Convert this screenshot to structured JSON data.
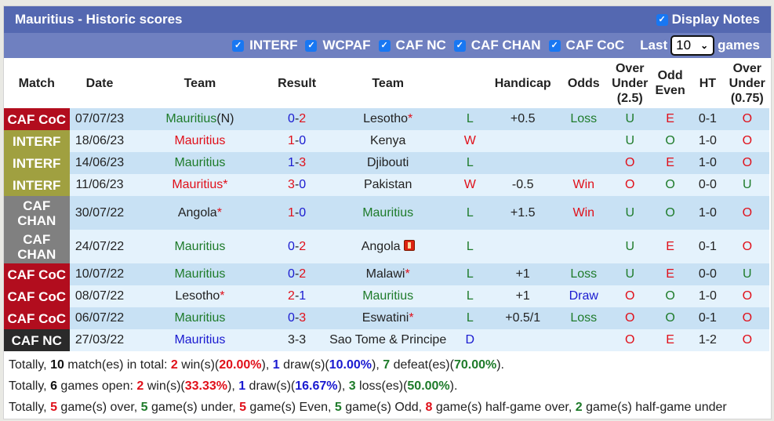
{
  "header": {
    "title": "Mauritius - Historic scores",
    "display_notes_label": "Display Notes",
    "display_notes_checked": true
  },
  "filters": {
    "items": [
      {
        "label": "INTERF",
        "checked": true
      },
      {
        "label": "WCPAF",
        "checked": true
      },
      {
        "label": "CAF NC",
        "checked": true
      },
      {
        "label": "CAF CHAN",
        "checked": true
      },
      {
        "label": "CAF CoC",
        "checked": true
      }
    ],
    "last_label": "Last",
    "last_value": "10",
    "games_label": "games"
  },
  "table": {
    "columns": [
      "Match",
      "Date",
      "Team",
      "Result",
      "Team",
      "",
      "Handicap",
      "Odds",
      "Over Under (2.5)",
      "Odd Even",
      "HT",
      "Over Under (0.75)"
    ],
    "column_lines": {
      "ou25": [
        "Over",
        "Under",
        "(2.5)"
      ],
      "oddeven": [
        "Odd",
        "Even"
      ],
      "ou075": [
        "Over",
        "Under",
        "(0.75)"
      ]
    },
    "rows": [
      {
        "match": "CAF CoC",
        "match_type": "coc",
        "date": "07/07/23",
        "home": "Mauritius",
        "home_suffix": "(N)",
        "home_color": "green",
        "home_star": false,
        "score_h": "0",
        "score_a": "2",
        "score_h_color": "blue",
        "score_a_color": "red",
        "away": "Lesotho",
        "away_color": "dark",
        "away_star": true,
        "away_card": false,
        "wl": "L",
        "handicap": "+0.5",
        "odds": "Loss",
        "ou": "U",
        "oe": "E",
        "ht": "0-1",
        "ou075": "O"
      },
      {
        "match": "INTERF",
        "match_type": "interf",
        "date": "18/06/23",
        "home": "Mauritius",
        "home_suffix": "",
        "home_color": "red",
        "home_star": false,
        "score_h": "1",
        "score_a": "0",
        "score_h_color": "red",
        "score_a_color": "blue",
        "away": "Kenya",
        "away_color": "dark",
        "away_star": false,
        "away_card": false,
        "wl": "W",
        "handicap": "",
        "odds": "",
        "ou": "U",
        "oe": "O",
        "ht": "1-0",
        "ou075": "O"
      },
      {
        "match": "INTERF",
        "match_type": "interf",
        "date": "14/06/23",
        "home": "Mauritius",
        "home_suffix": "",
        "home_color": "green",
        "home_star": false,
        "score_h": "1",
        "score_a": "3",
        "score_h_color": "blue",
        "score_a_color": "red",
        "away": "Djibouti",
        "away_color": "dark",
        "away_star": false,
        "away_card": false,
        "wl": "L",
        "handicap": "",
        "odds": "",
        "ou": "O",
        "oe": "E",
        "ht": "1-0",
        "ou075": "O"
      },
      {
        "match": "INTERF",
        "match_type": "interf",
        "date": "11/06/23",
        "home": "Mauritius",
        "home_suffix": "",
        "home_color": "red",
        "home_star": true,
        "score_h": "3",
        "score_a": "0",
        "score_h_color": "red",
        "score_a_color": "blue",
        "away": "Pakistan",
        "away_color": "dark",
        "away_star": false,
        "away_card": false,
        "wl": "W",
        "handicap": "-0.5",
        "odds": "Win",
        "ou": "O",
        "oe": "O",
        "ht": "0-0",
        "ou075": "U"
      },
      {
        "match": "CAF CHAN",
        "match_type": "chan",
        "date": "30/07/22",
        "home": "Angola",
        "home_suffix": "",
        "home_color": "dark",
        "home_star": true,
        "score_h": "1",
        "score_a": "0",
        "score_h_color": "red",
        "score_a_color": "blue",
        "away": "Mauritius",
        "away_color": "green",
        "away_star": false,
        "away_card": false,
        "wl": "L",
        "handicap": "+1.5",
        "odds": "Win",
        "ou": "U",
        "oe": "O",
        "ht": "1-0",
        "ou075": "O"
      },
      {
        "match": "CAF CHAN",
        "match_type": "chan",
        "date": "24/07/22",
        "home": "Mauritius",
        "home_suffix": "",
        "home_color": "green",
        "home_star": false,
        "score_h": "0",
        "score_a": "2",
        "score_h_color": "blue",
        "score_a_color": "red",
        "away": "Angola",
        "away_color": "dark",
        "away_star": false,
        "away_card": true,
        "wl": "L",
        "handicap": "",
        "odds": "",
        "ou": "U",
        "oe": "E",
        "ht": "0-1",
        "ou075": "O"
      },
      {
        "match": "CAF CoC",
        "match_type": "coc",
        "date": "10/07/22",
        "home": "Mauritius",
        "home_suffix": "",
        "home_color": "green",
        "home_star": false,
        "score_h": "0",
        "score_a": "2",
        "score_h_color": "blue",
        "score_a_color": "red",
        "away": "Malawi",
        "away_color": "dark",
        "away_star": true,
        "away_card": false,
        "wl": "L",
        "handicap": "+1",
        "odds": "Loss",
        "ou": "U",
        "oe": "E",
        "ht": "0-0",
        "ou075": "U"
      },
      {
        "match": "CAF CoC",
        "match_type": "coc",
        "date": "08/07/22",
        "home": "Lesotho",
        "home_suffix": "",
        "home_color": "dark",
        "home_star": true,
        "score_h": "2",
        "score_a": "1",
        "score_h_color": "red",
        "score_a_color": "blue",
        "away": "Mauritius",
        "away_color": "green",
        "away_star": false,
        "away_card": false,
        "wl": "L",
        "handicap": "+1",
        "odds": "Draw",
        "ou": "O",
        "oe": "O",
        "ht": "1-0",
        "ou075": "O"
      },
      {
        "match": "CAF CoC",
        "match_type": "coc",
        "date": "06/07/22",
        "home": "Mauritius",
        "home_suffix": "",
        "home_color": "green",
        "home_star": false,
        "score_h": "0",
        "score_a": "3",
        "score_h_color": "blue",
        "score_a_color": "red",
        "away": "Eswatini",
        "away_color": "dark",
        "away_star": true,
        "away_card": false,
        "wl": "L",
        "handicap": "+0.5/1",
        "odds": "Loss",
        "ou": "O",
        "oe": "O",
        "ht": "0-1",
        "ou075": "O"
      },
      {
        "match": "CAF NC",
        "match_type": "nc",
        "date": "27/03/22",
        "home": "Mauritius",
        "home_suffix": "",
        "home_color": "blue",
        "home_star": false,
        "score_h": "3",
        "score_a": "3",
        "score_h_color": "dark",
        "score_a_color": "dark",
        "away": "Sao Tome & Principe",
        "away_color": "dark",
        "away_star": false,
        "away_card": false,
        "wl": "D",
        "handicap": "",
        "odds": "",
        "ou": "O",
        "oe": "E",
        "ht": "1-2",
        "ou075": "O"
      }
    ]
  },
  "summary": {
    "line1": {
      "prefix": "Totally, ",
      "total": "10",
      "t1": " match(es) in total: ",
      "wins": "2",
      "t2": " win(s)(",
      "win_pct": "20.00%",
      "t3": "), ",
      "draws": "1",
      "t4": " draw(s)(",
      "draw_pct": "10.00%",
      "t5": "), ",
      "defeats": "7",
      "t6": " defeat(es)(",
      "defeat_pct": "70.00%",
      "t7": ")."
    },
    "line2": {
      "prefix": "Totally, ",
      "total": "6",
      "t1": " games open: ",
      "wins": "2",
      "t2": " win(s)(",
      "win_pct": "33.33%",
      "t3": "), ",
      "draws": "1",
      "t4": " draw(s)(",
      "draw_pct": "16.67%",
      "t5": "), ",
      "losses": "3",
      "t6": " loss(es)(",
      "loss_pct": "50.00%",
      "t7": ")."
    },
    "line3": {
      "prefix": "Totally, ",
      "over": "5",
      "t1": " game(s) over, ",
      "under": "5",
      "t2": " game(s) under, ",
      "even": "5",
      "t3": " game(s) Even, ",
      "odd": "5",
      "t4": " game(s) Odd, ",
      "hg_over": "8",
      "t5": " game(s) half-game over, ",
      "hg_under": "2",
      "t6": " game(s) half-game under"
    }
  }
}
